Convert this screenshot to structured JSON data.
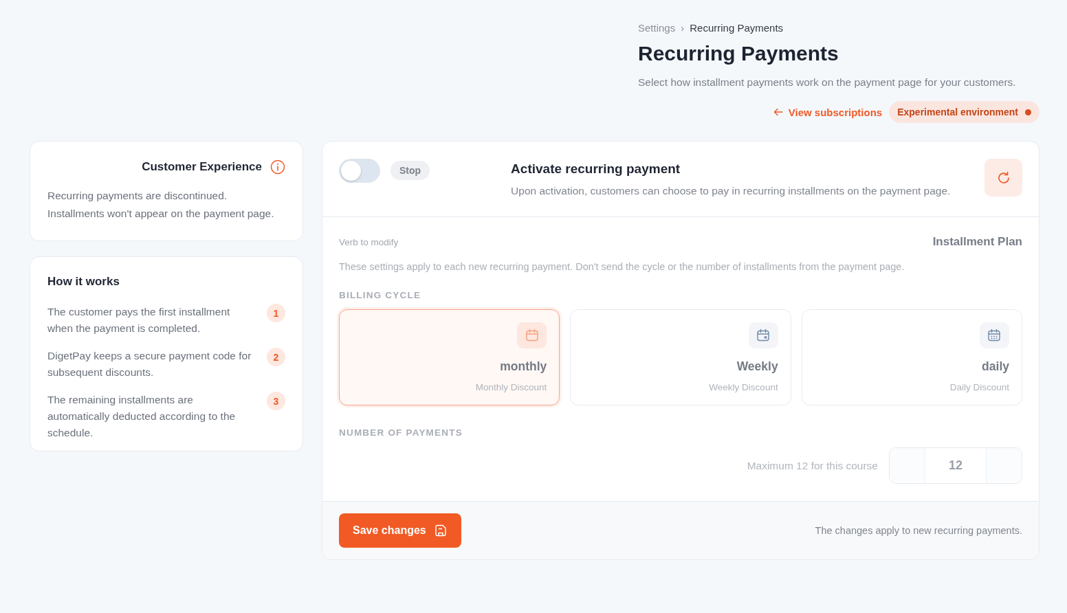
{
  "breadcrumb": [
    "Settings",
    "›",
    "Recurring Payments"
  ],
  "title": "Recurring Payments",
  "subtitle": "Select how installment payments work on the payment page for your customers.",
  "view_link": "View subscriptions",
  "environment_badge": "Experimental environment",
  "customer_experience": {
    "title": "Customer Experience",
    "text": "Recurring payments are discontinued. Installments won't appear on the payment page."
  },
  "how_it_works": {
    "title": "How it works",
    "steps": [
      {
        "number": "1",
        "text": "The customer pays the first installment when the payment is completed."
      },
      {
        "number": "2",
        "text": "DigetPay keeps a secure payment code for subsequent discounts."
      },
      {
        "number": "3",
        "text": "The remaining installments are automatically deducted according to the schedule."
      }
    ]
  },
  "activation": {
    "on": false,
    "state_label": "Stop",
    "title": "Activate recurring payment",
    "description": "Upon activation, customers can choose to pay in recurring installments on the payment page."
  },
  "plan": {
    "disabled": true,
    "verb_label": "Verb to modify",
    "title": "Installment Plan",
    "note": "These settings apply to each new recurring payment. Don't send the cycle or the number of installments from the payment page.",
    "billing_label": "BILLING CYCLE",
    "cycles": [
      {
        "kind": "month",
        "name": "monthly",
        "discount": "Monthly Discount",
        "selected": true
      },
      {
        "kind": "week",
        "name": "Weekly",
        "discount": "Weekly Discount",
        "selected": false
      },
      {
        "kind": "day",
        "name": "daily",
        "discount": "Daily Discount",
        "selected": false
      }
    ],
    "payments_label": "NUMBER OF PAYMENTS",
    "max_note": "Maximum 12 for this course",
    "count": "12"
  },
  "footer": {
    "save": "Save changes",
    "note": "The changes apply to new recurring payments."
  }
}
